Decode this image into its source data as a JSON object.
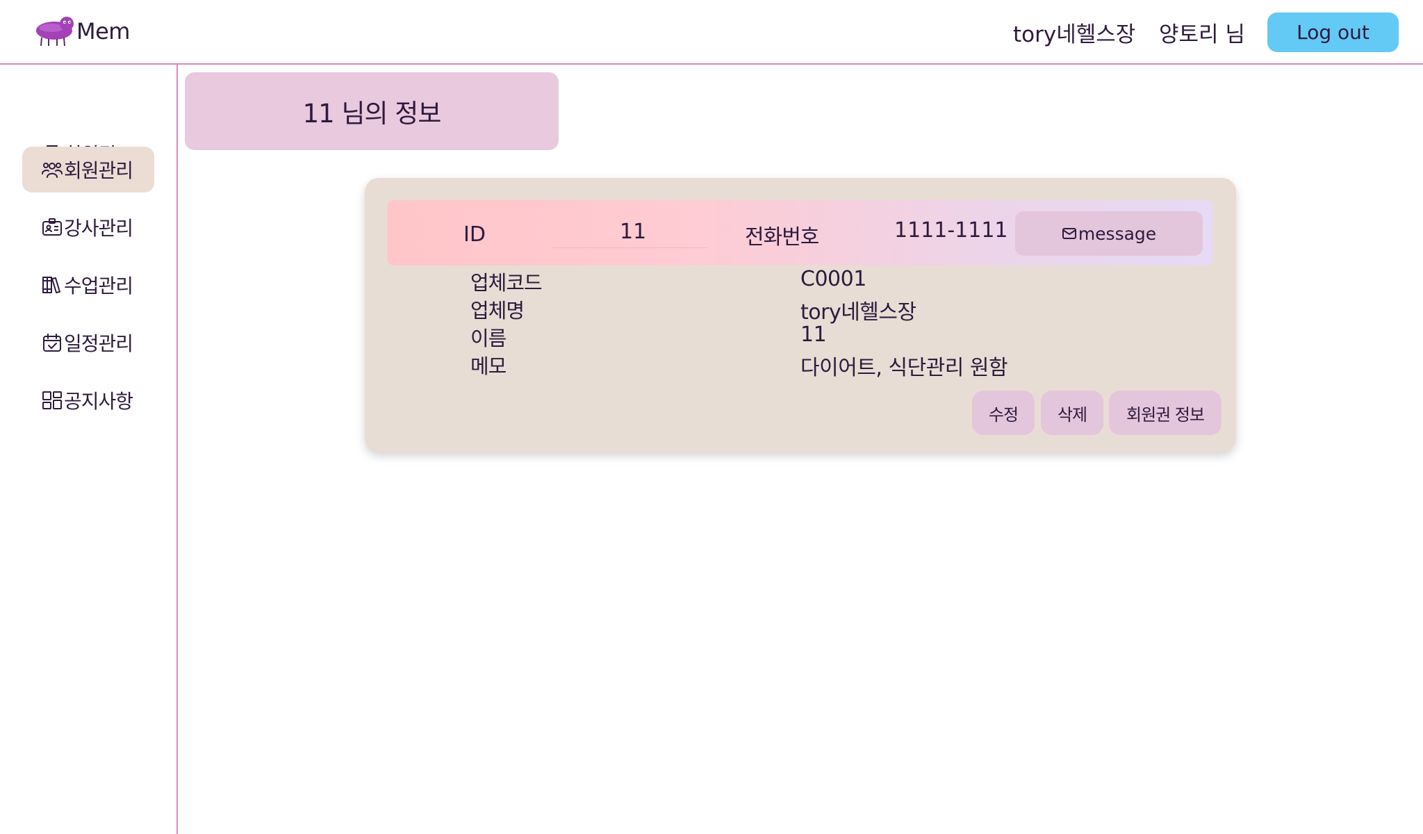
{
  "colors": {
    "accent_line": "#d98ab9",
    "logout_bg": "#63c9f5",
    "active_nav_bg": "#ebddd4",
    "title_bg": "#e8c9de",
    "card_bg": "#e8ddd4",
    "button_bg": "#e3c6dc",
    "text": "#2e1a3d"
  },
  "header": {
    "logo_text": "Mem",
    "logo_icon": "purple-creature-logo",
    "company_name": "tory네헬스장",
    "user_name": "양토리 님",
    "logout_label": "Log out"
  },
  "sidebar": {
    "items": [
      {
        "label": "회원권",
        "icon": "ticket-icon",
        "active": false
      },
      {
        "label": "회원관리",
        "icon": "users-icon",
        "active": true
      },
      {
        "label": "강사관리",
        "icon": "id-badge-icon",
        "active": false
      },
      {
        "label": "수업관리",
        "icon": "books-icon",
        "active": false
      },
      {
        "label": "일정관리",
        "icon": "calendar-check-icon",
        "active": false
      },
      {
        "label": "공지사항",
        "icon": "layout-icon",
        "active": false
      }
    ]
  },
  "main": {
    "page_title": "11 님의 정보",
    "summary": {
      "id_label": "ID",
      "id_value": "11",
      "phone_label": "전화번호",
      "phone_value": "1111-1111",
      "message_label": "message",
      "message_icon": "mail-icon"
    },
    "details": [
      {
        "label": "업체코드",
        "value": "C0001"
      },
      {
        "label": "업체명",
        "value": "tory네헬스장"
      },
      {
        "label": "이름",
        "value": "11"
      },
      {
        "label": "메모",
        "value": "다이어트, 식단관리 원함"
      }
    ],
    "actions": {
      "edit_label": "수정",
      "delete_label": "삭제",
      "membership_label": "회원권 정보"
    }
  }
}
